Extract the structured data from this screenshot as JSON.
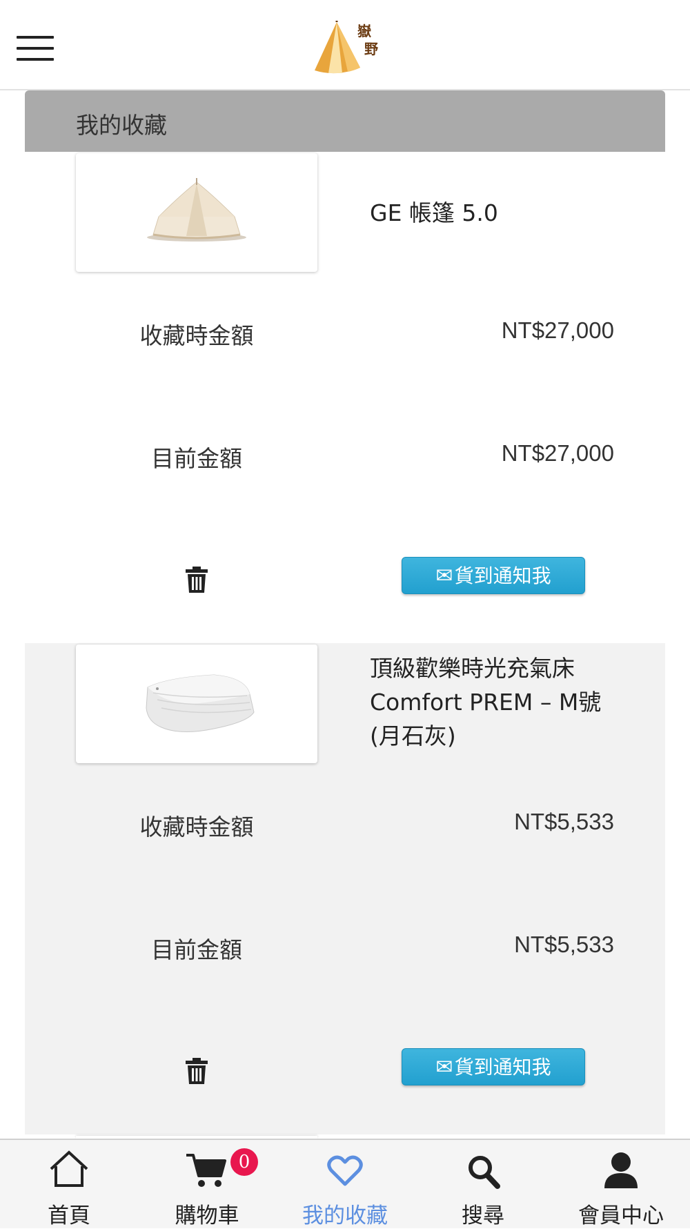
{
  "header": {
    "logo_icon": "tent-logo",
    "logo_text": "嶽野"
  },
  "section": {
    "title": "我的收藏"
  },
  "favorites": [
    {
      "name": "GE 帳篷 5.0",
      "image_icon": "bell-tent",
      "saved_price_label": "收藏時金額",
      "saved_price": "NT$27,000",
      "current_price_label": "目前金額",
      "current_price": "NT$27,000",
      "delete_icon": "trash-icon",
      "notify_label": "貨到通知我",
      "notify_icon": "envelope-icon"
    },
    {
      "name": "頂級歡樂時光充氣床 Comfort PREM – M號 (月石灰)",
      "image_icon": "air-mattress",
      "saved_price_label": "收藏時金額",
      "saved_price": "NT$5,533",
      "current_price_label": "目前金額",
      "current_price": "NT$5,533",
      "delete_icon": "trash-icon",
      "notify_label": "貨到通知我",
      "notify_icon": "envelope-icon"
    }
  ],
  "bottom_nav": {
    "items": [
      {
        "label": "首頁",
        "icon": "home-icon",
        "active": false
      },
      {
        "label": "購物車",
        "icon": "cart-icon",
        "active": false,
        "badge": "0"
      },
      {
        "label": "我的收藏",
        "icon": "heart-icon",
        "active": true
      },
      {
        "label": "搜尋",
        "icon": "search-icon",
        "active": false
      },
      {
        "label": "會員中心",
        "icon": "user-icon",
        "active": false
      }
    ]
  },
  "colors": {
    "title_bar": "#aaaaaa",
    "alt_row": "#f2f2f2",
    "notify_button": "#2aa8d6",
    "active_nav": "#5c8fe0",
    "badge": "#e8174e",
    "logo": "#e8a53c"
  }
}
